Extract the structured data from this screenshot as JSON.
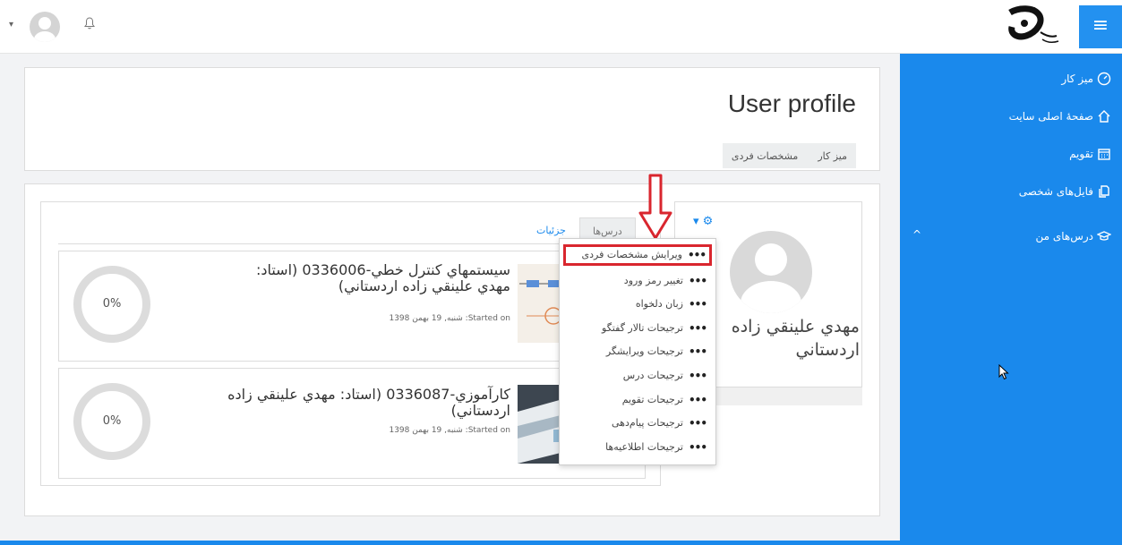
{
  "topbar": {
    "caret": "▾",
    "bell": "🔔",
    "menu_icon": "≡"
  },
  "sidebar": {
    "items": [
      {
        "label": "میز کار",
        "icon": "dashboard-icon"
      },
      {
        "label": "صفحهٔ اصلی سایت",
        "icon": "home-icon"
      },
      {
        "label": "تقویم",
        "icon": "calendar-icon"
      },
      {
        "label": "فایل‌های شخصی",
        "icon": "file-icon"
      },
      {
        "label": "درس‌های من",
        "icon": "graduation-cap-icon"
      }
    ],
    "collapse_icon": "^"
  },
  "header": {
    "title": "User profile",
    "breadcrumb": [
      "میز کار",
      "مشخصات فردی"
    ]
  },
  "profile": {
    "name": "مهدي علينقي زاده اردستاني"
  },
  "tabs": [
    {
      "label": "جزئيات"
    },
    {
      "label": "درس‌ها"
    }
  ],
  "courses": [
    {
      "title": "سيستمهاي كنترل خطي-0336006 (استاد: مهدي علينقي زاده اردستاني)",
      "date": "Started on: شنبه, 19 بهمن 1398",
      "progress": "0%"
    },
    {
      "title": "كارآموزي-0336087 (استاد: مهدي علينقي زاده اردستاني)",
      "date": "Started on: شنبه, 19 بهمن 1398",
      "progress": "0%"
    }
  ],
  "settings_menu": {
    "gear": "⚙",
    "items": [
      {
        "label": "ویرایش مشخصات فردی"
      },
      {
        "label": "تغییر رمز ورود"
      },
      {
        "label": "زبان دلخواه"
      },
      {
        "label": "ترجیحات تالار گفتگو"
      },
      {
        "label": "ترجیحات ویرایشگر"
      },
      {
        "label": "ترجیحات درس"
      },
      {
        "label": "ترجیحات تقویم"
      },
      {
        "label": "ترجیحات پیام‌دهی"
      },
      {
        "label": "ترجیحات اطلاعیه‌ها"
      }
    ],
    "dots": "•••"
  },
  "colors": {
    "accent": "#1a89ec",
    "highlight": "#d9262e"
  }
}
